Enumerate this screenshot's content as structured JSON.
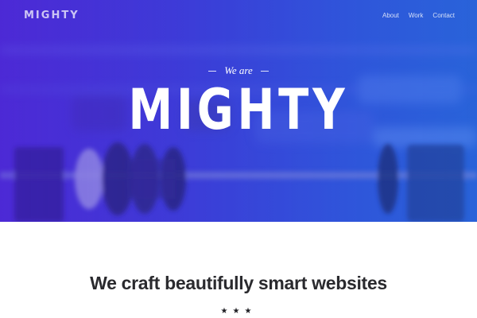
{
  "header": {
    "logo": "MIGHTY",
    "nav": [
      {
        "label": "About"
      },
      {
        "label": "Work"
      },
      {
        "label": "Contact"
      }
    ]
  },
  "hero": {
    "eyebrow": "We are",
    "title": "MIGHTY",
    "background_image": "foosball-table-photo",
    "gradient_colors": [
      "#4a2bd0",
      "#2a63d8"
    ]
  },
  "intro": {
    "heading": "We craft beautifully smart websites",
    "divider": "★★★"
  },
  "colors": {
    "text_dark": "#2a2a2e",
    "white": "#ffffff"
  }
}
